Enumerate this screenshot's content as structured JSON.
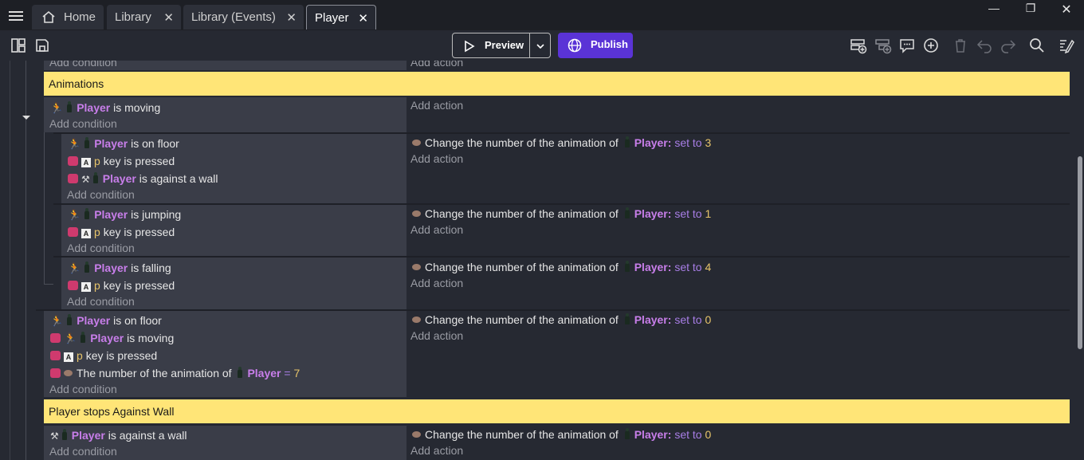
{
  "tabs": [
    {
      "label": "Home"
    },
    {
      "label": "Library"
    },
    {
      "label": "Library (Events)"
    },
    {
      "label": "Player"
    }
  ],
  "toolbar": {
    "preview_label": "Preview",
    "publish_label": "Publish"
  },
  "events": {
    "top_add_condition": "Add condition",
    "top_add_action": "Add action",
    "comment_animations": "Animations",
    "comment_stops": "Player stops Against Wall",
    "add_condition": "Add condition",
    "add_action": "Add action",
    "player": "Player",
    "player_colon": "Player:",
    "is_moving": "is moving",
    "is_on_floor": "is on floor",
    "is_jumping": "is jumping",
    "is_falling": "is falling",
    "is_against_wall": "is against a wall",
    "key_p": "p",
    "key_pressed": "key is pressed",
    "change_anim": "Change the number of the animation of",
    "set_to": "set to",
    "val_3": "3",
    "val_1": "1",
    "val_4": "4",
    "val_0": "0",
    "num_anim_of": "The number of the animation of",
    "eq": "=",
    "val_7": "7"
  },
  "colors": {
    "comment_bg": "#ffe577",
    "publish_bg": "#5a33d6",
    "object_name": "#c87eea",
    "value": "#e7c46a"
  }
}
